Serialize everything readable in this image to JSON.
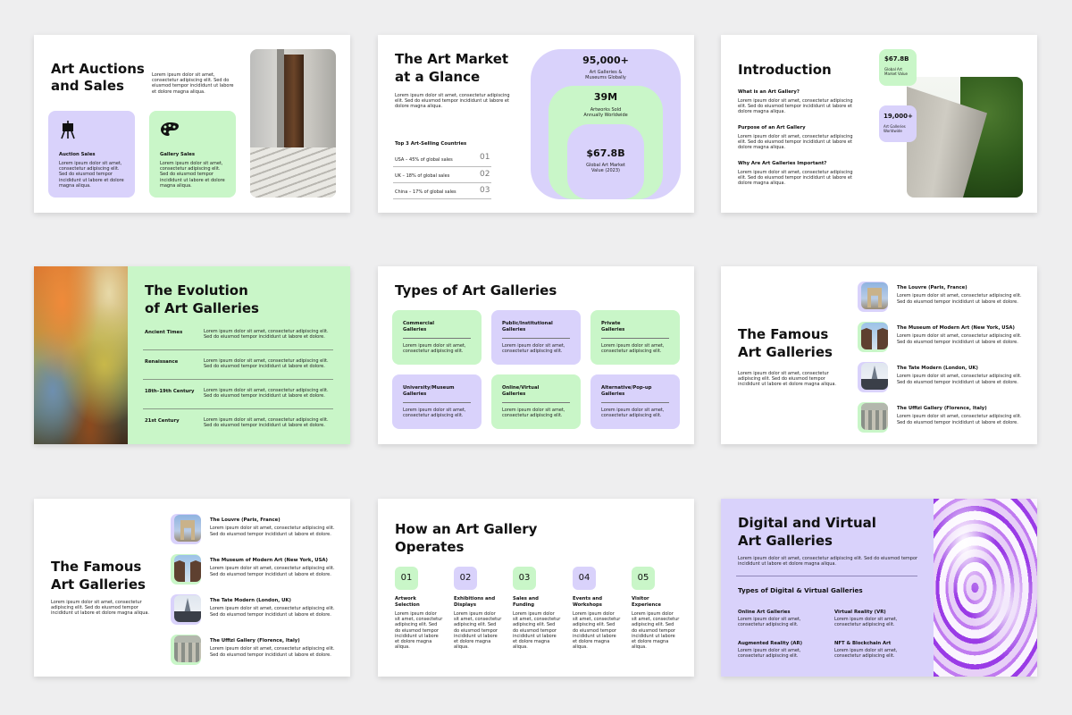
{
  "lorem": {
    "short": "Lorem ipsum dolor sit amet, consectetur adipiscing elit. Sed do eiusmod tempor incididunt ut labore et dolore magna aliqua.",
    "line1": "Lorem ipsum dolor sit amet, consectetur adipiscing elit.",
    "line2": "Sed do eiusmod tempor incididunt ut labore et dolore.",
    "two": "Lorem ipsum dolor sit amet, consectetur adipiscing elit."
  },
  "s1": {
    "title_1": "Art Auctions",
    "title_2": "and Sales",
    "intro": "Lorem ipsum dolor sit amet, consectetur adipiscing elit. Sed do eiusmod tempor incididunt ut labore et dolore magna aliqua.",
    "cards": [
      {
        "label": "Auction Sales",
        "icon": "easel-icon",
        "text": "Lorem ipsum dolor sit amet, consectetur adipiscing elit. Sed do eiusmod tempor incididunt ut labore et dolore magna aliqua."
      },
      {
        "label": "Gallery Sales",
        "icon": "palette-icon",
        "text": "Lorem ipsum dolor sit amet, consectetur adipiscing elit. Sed do eiusmod tempor incididunt ut labore et dolore magna aliqua."
      }
    ]
  },
  "s2": {
    "title_1": "The Art Market",
    "title_2": "at a Glance",
    "intro": "Lorem ipsum dolor sit amet, consectetur adipiscing elit. Sed do eiusmod tempor incididunt ut labore et dolore magna aliqua.",
    "subhead": "Top 3 Art-Selling Countries",
    "rows": [
      {
        "label": "USA – 45% of global sales",
        "num": "01"
      },
      {
        "label": "UK – 18% of global sales",
        "num": "02"
      },
      {
        "label": "China – 17% of global sales",
        "num": "03"
      }
    ],
    "stats": [
      {
        "value": "95,000+",
        "label_1": "Art Galleries &",
        "label_2": "Museums Globally"
      },
      {
        "value": "39M",
        "label_1": "Artworks Sold",
        "label_2": "Annually Worldwide"
      },
      {
        "value": "$67.8B",
        "label_1": "Global Art Market",
        "label_2": "Value (2023)"
      }
    ]
  },
  "s3": {
    "title": "Introduction",
    "items": [
      {
        "q": "What is an Art Gallery?",
        "a": "Lorem ipsum dolor sit amet, consectetur adipiscing elit. Sed do eiusmod tempor incididunt ut labore et dolore magna aliqua."
      },
      {
        "q": "Purpose of an Art Gallery",
        "a": "Lorem ipsum dolor sit amet, consectetur adipiscing elit. Sed do eiusmod tempor incididunt ut labore et dolore magna aliqua."
      },
      {
        "q": "Why Are Art Galleries Important?",
        "a": "Lorem ipsum dolor sit amet, consectetur adipiscing elit. Sed do eiusmod tempor incididunt ut labore et dolore magna aliqua."
      }
    ],
    "badges": [
      {
        "value": "$67.8B",
        "label_1": "Global Art",
        "label_2": "Market Value"
      },
      {
        "value": "19,000+",
        "label_1": "Art Galleries",
        "label_2": "Worldwide"
      }
    ]
  },
  "s4": {
    "title_1": "The Evolution",
    "title_2": "of Art Galleries",
    "rows": [
      {
        "era": "Ancient Times",
        "text": "Lorem ipsum dolor sit amet, consectetur adipiscing elit. Sed do eiusmod tempor incididunt ut labore et dolore."
      },
      {
        "era": "Renaissance",
        "text": "Lorem ipsum dolor sit amet, consectetur adipiscing elit. Sed do eiusmod tempor incididunt ut labore et dolore."
      },
      {
        "era": "18th–19th Century",
        "text": "Lorem ipsum dolor sit amet, consectetur adipiscing elit. Sed do eiusmod tempor incididunt ut labore et dolore."
      },
      {
        "era": "21st Century",
        "text": "Lorem ipsum dolor sit amet, consectetur adipiscing elit. Sed do eiusmod tempor incididunt ut labore et dolore."
      }
    ]
  },
  "s5": {
    "title": "Types of Art Galleries",
    "cards": [
      {
        "l1": "Commercial",
        "l2": "Galleries",
        "text": "Lorem ipsum dolor sit amet, consectetur adipiscing elit.",
        "color": "mint"
      },
      {
        "l1": "Public/Institutional",
        "l2": "Galleries",
        "text": "Lorem ipsum dolor sit amet, consectetur adipiscing elit.",
        "color": "lav"
      },
      {
        "l1": "Private",
        "l2": "Galleries",
        "text": "Lorem ipsum dolor sit amet, consectetur adipiscing elit.",
        "color": "mint"
      },
      {
        "l1": "University/Museum",
        "l2": "Galleries",
        "text": "Lorem ipsum dolor sit amet, consectetur adipiscing elit.",
        "color": "lav"
      },
      {
        "l1": "Online/Virtual",
        "l2": "Galleries",
        "text": "Lorem ipsum dolor sit amet, consectetur adipiscing elit.",
        "color": "mint"
      },
      {
        "l1": "Alternative/Pop-up",
        "l2": "Galleries",
        "text": "Lorem ipsum dolor sit amet, consectetur adipiscing elit.",
        "color": "lav"
      }
    ]
  },
  "s6": {
    "title_1": "The Famous",
    "title_2": "Art Galleries",
    "intro": "Lorem ipsum dolor sit amet, consectetur adipiscing elit. Sed do eiusmod tempor incididunt ut labore et dolore magna aliqua.",
    "items": [
      {
        "name": "The Louvre (Paris, France)",
        "line1": "Lorem ipsum dolor sit amet, consectetur adipiscing elit.",
        "line2": "Sed do eiusmod tempor incididunt ut labore et dolore."
      },
      {
        "name": "The Museum of Modern Art (New York, USA)",
        "line1": "Lorem ipsum dolor sit amet, consectetur adipiscing elit.",
        "line2": "Sed do eiusmod tempor incididunt ut labore et dolore."
      },
      {
        "name": "The Tate Modern (London, UK)",
        "line1": "Lorem ipsum dolor sit amet, consectetur adipiscing elit.",
        "line2": "Sed do eiusmod tempor incididunt ut labore et dolore."
      },
      {
        "name": "The Uffizi Gallery (Florence, Italy)",
        "line1": "Lorem ipsum dolor sit amet, consectetur adipiscing elit.",
        "line2": "Sed do eiusmod tempor incididunt ut labore et dolore."
      }
    ]
  },
  "s8": {
    "title_1": "How an Art Gallery",
    "title_2": "Operates",
    "steps": [
      {
        "num": "01",
        "l1": "Artwork",
        "l2": "Selection",
        "text": "Lorem ipsum dolor sit amet, consectetur adipiscing elit. Sed do eiusmod tempor incididunt ut labore et dolore magna aliqua.",
        "color": "mint"
      },
      {
        "num": "02",
        "l1": "Exhibitions and",
        "l2": "Displays",
        "text": "Lorem ipsum dolor sit amet, consectetur adipiscing elit. Sed do eiusmod tempor incididunt ut labore et dolore magna aliqua.",
        "color": "lav"
      },
      {
        "num": "03",
        "l1": "Sales and",
        "l2": "Funding",
        "text": "Lorem ipsum dolor sit amet, consectetur adipiscing elit. Sed do eiusmod tempor incididunt ut labore et dolore magna aliqua.",
        "color": "mint"
      },
      {
        "num": "04",
        "l1": "Events and",
        "l2": "Workshops",
        "text": "Lorem ipsum dolor sit amet, consectetur adipiscing elit. Sed do eiusmod tempor incididunt ut labore et dolore magna aliqua.",
        "color": "lav"
      },
      {
        "num": "05",
        "l1": "Visitor",
        "l2": "Experience",
        "text": "Lorem ipsum dolor sit amet, consectetur adipiscing elit. Sed do eiusmod tempor incididunt ut labore et dolore magna aliqua.",
        "color": "mint"
      }
    ]
  },
  "s9": {
    "title_1": "Digital and Virtual",
    "title_2": "Art Galleries",
    "intro": "Lorem ipsum dolor sit amet, consectetur adipiscing elit. Sed do eiusmod tempor incididunt ut labore et dolore magna aliqua.",
    "subhead": "Types of Digital & Virtual Galleries",
    "items": [
      {
        "label": "Online Art Galleries",
        "text": "Lorem ipsum dolor sit amet, consectetur adipiscing elit."
      },
      {
        "label": "Virtual Reality (VR)",
        "text": "Lorem ipsum dolor sit amet, consectetur adipiscing elit."
      },
      {
        "label": "Augmented Reality (AR)",
        "text": "Lorem ipsum dolor sit amet, consectetur adipiscing elit."
      },
      {
        "label": "NFT & Blockchain Art",
        "text": "Lorem ipsum dolor sit amet, consectetur adipiscing elit."
      }
    ]
  },
  "colors": {
    "lavender": "#d9d2fb",
    "mint": "#c9f6c8",
    "marble_purple": "#8b2be0"
  }
}
